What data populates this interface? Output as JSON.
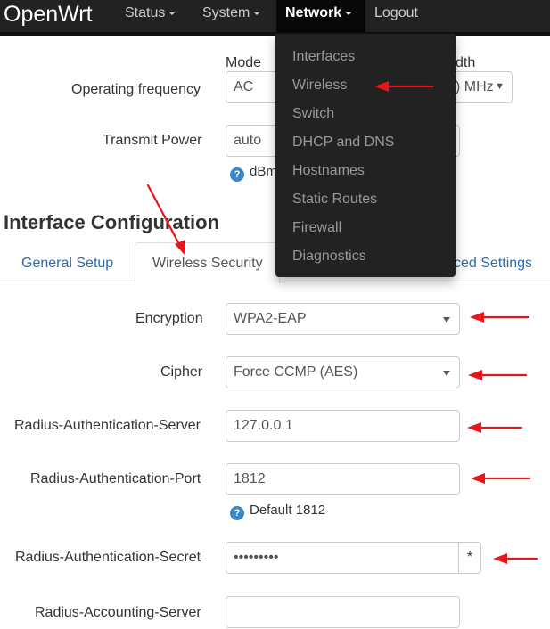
{
  "navbar": {
    "brand": "OpenWrt",
    "items": [
      {
        "label": "Status",
        "dropdown": true
      },
      {
        "label": "System",
        "dropdown": true
      },
      {
        "label": "Network",
        "dropdown": true,
        "active": true
      },
      {
        "label": "Logout",
        "dropdown": false
      }
    ]
  },
  "network_menu": {
    "items": [
      "Interfaces",
      "Wireless",
      "Switch",
      "DHCP and DNS",
      "Hostnames",
      "Static Routes",
      "Firewall",
      "Diagnostics"
    ]
  },
  "device_config": {
    "mode_header": "Mode",
    "width_header_fragment": "dth",
    "operating_frequency": {
      "label": "Operating frequency",
      "mode_value": "AC",
      "width_value_fragment": ") MHz"
    },
    "transmit_power": {
      "label": "Transmit Power",
      "value": "auto",
      "help_fragment": "dBm"
    }
  },
  "interface_config": {
    "heading": "Interface Configuration",
    "tabs": {
      "general": "General Setup",
      "wireless_security": "Wireless Security",
      "advanced_fragment": "ced Settings"
    },
    "encryption": {
      "label": "Encryption",
      "value": "WPA2-EAP"
    },
    "cipher": {
      "label": "Cipher",
      "value": "Force CCMP (AES)"
    },
    "radius_auth_server": {
      "label": "Radius-Authentication-Server",
      "value": "127.0.0.1"
    },
    "radius_auth_port": {
      "label": "Radius-Authentication-Port",
      "value": "1812",
      "help": "Default 1812"
    },
    "radius_auth_secret": {
      "label": "Radius-Authentication-Secret",
      "value": "•••••••••",
      "reveal": "*"
    },
    "radius_acct_server": {
      "label": "Radius-Accounting-Server",
      "value": ""
    }
  },
  "colors": {
    "navbar": "#222222",
    "link": "#2a6ab0",
    "annotation": "#e8151b"
  }
}
